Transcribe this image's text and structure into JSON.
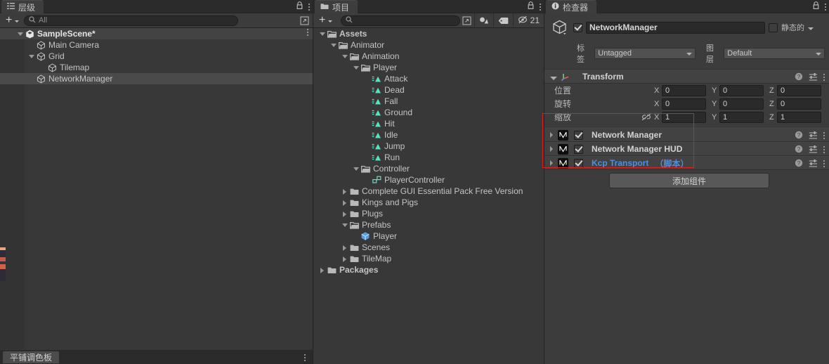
{
  "hierarchy": {
    "tab_label": "层级",
    "tab_icon": "hierarchy-icon",
    "add_label": "+",
    "search_placeholder": "All",
    "rows": [
      {
        "label": "SampleScene*",
        "depth": 0,
        "twisty": "open",
        "icon": "unity-scene-icon",
        "state": "scene",
        "has_menu": true
      },
      {
        "label": "Main Camera",
        "depth": 1,
        "twisty": "none",
        "icon": "gameobject-icon",
        "state": "normal",
        "has_menu": false
      },
      {
        "label": "Grid",
        "depth": 1,
        "twisty": "open",
        "icon": "gameobject-icon",
        "state": "normal",
        "has_menu": false
      },
      {
        "label": "Tilemap",
        "depth": 2,
        "twisty": "none",
        "icon": "gameobject-icon",
        "state": "normal",
        "has_menu": false
      },
      {
        "label": "NetworkManager",
        "depth": 1,
        "twisty": "none",
        "icon": "gameobject-icon",
        "state": "selected",
        "has_menu": false
      }
    ]
  },
  "project": {
    "tab_label": "项目",
    "tab_icon": "folder-icon",
    "add_label": "+",
    "search_placeholder": "",
    "hidden_count": "21",
    "rows": [
      {
        "label": "Assets",
        "depth": 0,
        "twisty": "open",
        "icon": "folder-open-icon",
        "bold": true
      },
      {
        "label": "Animator",
        "depth": 1,
        "twisty": "open",
        "icon": "folder-open-icon",
        "bold": false
      },
      {
        "label": "Animation",
        "depth": 2,
        "twisty": "open",
        "icon": "folder-open-icon",
        "bold": false
      },
      {
        "label": "Player",
        "depth": 3,
        "twisty": "open",
        "icon": "folder-open-icon",
        "bold": false
      },
      {
        "label": "Attack",
        "depth": 4,
        "twisty": "none",
        "icon": "animation-clip-icon",
        "bold": false
      },
      {
        "label": "Dead",
        "depth": 4,
        "twisty": "none",
        "icon": "animation-clip-icon",
        "bold": false
      },
      {
        "label": "Fall",
        "depth": 4,
        "twisty": "none",
        "icon": "animation-clip-icon",
        "bold": false
      },
      {
        "label": "Ground",
        "depth": 4,
        "twisty": "none",
        "icon": "animation-clip-icon",
        "bold": false
      },
      {
        "label": "Hit",
        "depth": 4,
        "twisty": "none",
        "icon": "animation-clip-icon",
        "bold": false
      },
      {
        "label": "Idle",
        "depth": 4,
        "twisty": "none",
        "icon": "animation-clip-icon",
        "bold": false
      },
      {
        "label": "Jump",
        "depth": 4,
        "twisty": "none",
        "icon": "animation-clip-icon",
        "bold": false
      },
      {
        "label": "Run",
        "depth": 4,
        "twisty": "none",
        "icon": "animation-clip-icon",
        "bold": false
      },
      {
        "label": "Controller",
        "depth": 3,
        "twisty": "open",
        "icon": "folder-open-icon",
        "bold": false
      },
      {
        "label": "PlayerController",
        "depth": 4,
        "twisty": "none",
        "icon": "animator-controller-icon",
        "bold": false
      },
      {
        "label": "Complete GUI Essential Pack Free Version",
        "depth": 2,
        "twisty": "closed",
        "icon": "folder-icon",
        "bold": false
      },
      {
        "label": "Kings and Pigs",
        "depth": 2,
        "twisty": "closed",
        "icon": "folder-icon",
        "bold": false
      },
      {
        "label": "Plugs",
        "depth": 2,
        "twisty": "closed",
        "icon": "folder-icon",
        "bold": false
      },
      {
        "label": "Prefabs",
        "depth": 2,
        "twisty": "open",
        "icon": "folder-open-icon",
        "bold": false
      },
      {
        "label": "Player",
        "depth": 3,
        "twisty": "none",
        "icon": "prefab-icon",
        "bold": false
      },
      {
        "label": "Scenes",
        "depth": 2,
        "twisty": "closed",
        "icon": "folder-icon",
        "bold": false
      },
      {
        "label": "TileMap",
        "depth": 2,
        "twisty": "closed",
        "icon": "folder-icon",
        "bold": false
      },
      {
        "label": "Packages",
        "depth": 0,
        "twisty": "closed",
        "icon": "folder-icon",
        "bold": true
      }
    ]
  },
  "inspector": {
    "tab_label": "检查器",
    "tab_icon": "info-icon",
    "object_name": "NetworkManager",
    "enabled": true,
    "static_label": "静态的",
    "static_checked": false,
    "tag_label": "标签",
    "tag_value": "Untagged",
    "layer_label": "图层",
    "layer_value": "Default",
    "transform": {
      "title": "Transform",
      "rows": [
        {
          "name": "位置",
          "x": "0",
          "y": "0",
          "z": "0",
          "link": false
        },
        {
          "name": "旋转",
          "x": "0",
          "y": "0",
          "z": "0",
          "link": false
        },
        {
          "name": "缩放",
          "x": "1",
          "y": "1",
          "z": "1",
          "link": true
        }
      ],
      "axis_labels": [
        "X",
        "Y",
        "Z"
      ]
    },
    "components": [
      {
        "title": "Network Manager",
        "suffix": "",
        "enabled": true,
        "is_script": false
      },
      {
        "title": "Network Manager HUD",
        "suffix": "",
        "enabled": true,
        "is_script": false
      },
      {
        "title": "Kcp Transport",
        "suffix": "（脚本）",
        "enabled": true,
        "is_script": true
      }
    ],
    "add_component_label": "添加组件",
    "highlight_color": "#e02020"
  },
  "palette_bar": {
    "tab_label": "平铺调色板"
  }
}
